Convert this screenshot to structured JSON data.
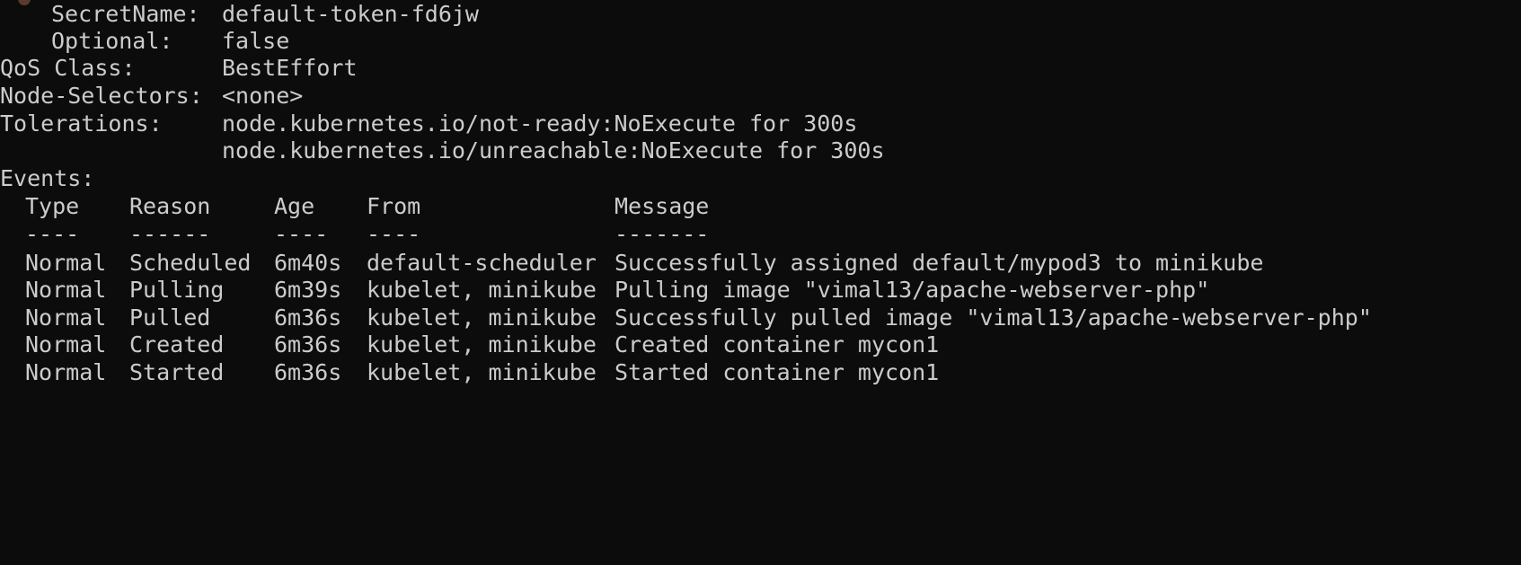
{
  "volume": {
    "secret_name_key": "SecretName:",
    "secret_name_value": "default-token-fd6jw",
    "optional_key": "Optional:",
    "optional_value": "false"
  },
  "pod": {
    "qos_class_key": "QoS Class:",
    "qos_class_value": "BestEffort",
    "node_selectors_key": "Node-Selectors:",
    "node_selectors_value": "<none>",
    "tolerations_key": "Tolerations:",
    "tolerations": [
      "node.kubernetes.io/not-ready:NoExecute for 300s",
      "node.kubernetes.io/unreachable:NoExecute for 300s"
    ]
  },
  "events": {
    "title": "Events:",
    "headers": [
      "Type",
      "Reason",
      "Age",
      "From",
      "Message"
    ],
    "separators": [
      "----",
      "------",
      "----",
      "----",
      "-------"
    ],
    "rows": [
      [
        "Normal",
        "Scheduled",
        "6m40s",
        "default-scheduler",
        "Successfully assigned default/mypod3 to minikube"
      ],
      [
        "Normal",
        "Pulling",
        "6m39s",
        "kubelet, minikube",
        "Pulling image \"vimal13/apache-webserver-php\""
      ],
      [
        "Normal",
        "Pulled",
        "6m36s",
        "kubelet, minikube",
        "Successfully pulled image \"vimal13/apache-webserver-php\""
      ],
      [
        "Normal",
        "Created",
        "6m36s",
        "kubelet, minikube",
        "Created container mycon1"
      ],
      [
        "Normal",
        "Started",
        "6m36s",
        "kubelet, minikube",
        "Started container mycon1"
      ]
    ]
  },
  "colors": {
    "background": "#0c0c0c",
    "foreground": "#cccccc"
  }
}
